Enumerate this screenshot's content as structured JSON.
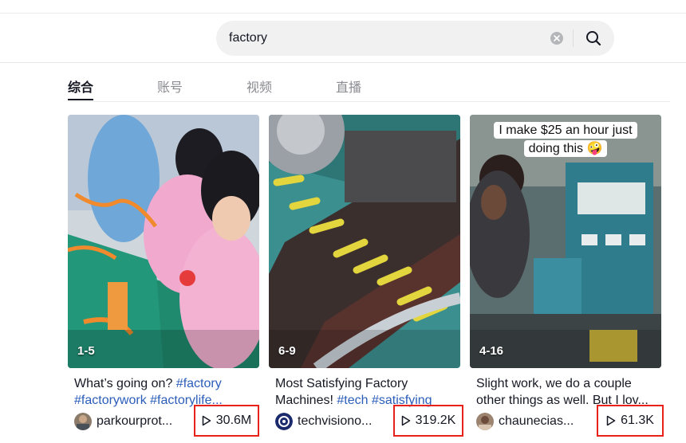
{
  "search": {
    "query": "factory"
  },
  "tabs": [
    {
      "label": "综合",
      "active": true
    },
    {
      "label": "账号",
      "active": false
    },
    {
      "label": "视频",
      "active": false
    },
    {
      "label": "直播",
      "active": false
    }
  ],
  "videos": [
    {
      "count_badge": "1-5",
      "caption_text": "What’s going on? ",
      "caption_tags": "#factory #factorywork #factorylife...",
      "author": "parkourprot...",
      "views": "30.6M"
    },
    {
      "count_badge": "6-9",
      "caption_text": "Most Satisfying Factory Machines! ",
      "caption_tags": "#tech #satisfying",
      "author": "techvisiono...",
      "views": "319.2K"
    },
    {
      "count_badge": "4-16",
      "overlay_text": "I make $25 an hour just doing this 🤪",
      "caption_text": "Slight work, we do a couple other things as well. But I lov...",
      "caption_tags": "",
      "author": "chaunecias...",
      "views": "61.3K"
    }
  ],
  "colors": {
    "highlight_box": "#e8221b",
    "hashtag": "#2b5db9",
    "search_bg": "#f1f1f2"
  }
}
